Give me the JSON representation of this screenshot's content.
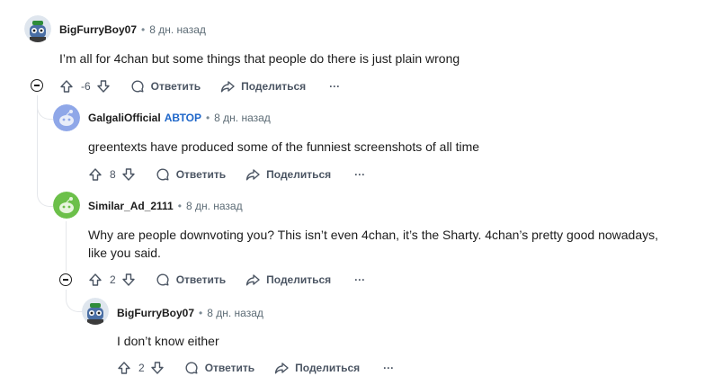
{
  "comments": [
    {
      "author": "BigFurryBoy07",
      "time": "8 дн. назад",
      "text": "I’m all for 4chan but some things that people do there is just plain wrong",
      "score": "-6",
      "avatar_color": "#4a6fa5"
    },
    {
      "author": "GalgaliOfficial",
      "op_badge": "АВТОР",
      "time": "8 дн. назад",
      "text": "greentexts have produced some of the funniest screenshots of all time",
      "score": "8",
      "avatar_color": "#8fa7e8"
    },
    {
      "author": "Similar_Ad_2111",
      "time": "8 дн. назад",
      "text_line1": "Why are people downvoting you? This isn’t even 4chan, it’s the Sharty. 4chan’s pretty good nowadays,",
      "text_line2": "like you said.",
      "score": "2",
      "avatar_color": "#6cc04a"
    },
    {
      "author": "BigFurryBoy07",
      "time": "8 дн. назад",
      "text": "I don’t know either",
      "score": "2",
      "avatar_color": "#4a6fa5"
    }
  ],
  "actions": {
    "reply": "Ответить",
    "share": "Поделиться",
    "more": "···"
  },
  "separator": "•",
  "colors": {
    "op_badge": "#1e66c9",
    "thread_line": "#e5e7eb"
  }
}
